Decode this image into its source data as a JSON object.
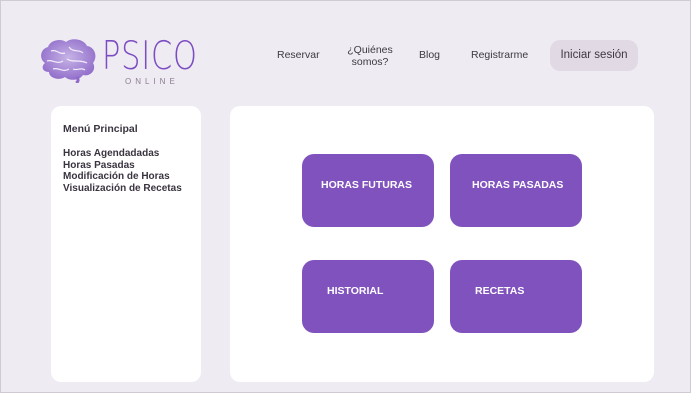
{
  "brand": {
    "name": "PSICO",
    "sub": "ONLINE",
    "accent": "#7c4dc2"
  },
  "nav": {
    "reservar": "Reservar",
    "quienes_line1": "¿Quiénes",
    "quienes_line2": "somos?",
    "blog": "Blog",
    "registrarme": "Registrarme",
    "login": "Iniciar sesión"
  },
  "sidebar": {
    "title": "Menú Principal",
    "items": [
      {
        "label": "Horas Agendadadas"
      },
      {
        "label": "Horas Pasadas"
      },
      {
        "label": "Modificación de Horas"
      },
      {
        "label": "Visualización de Recetas"
      }
    ]
  },
  "cards": [
    {
      "label": "HORAS FUTURAS",
      "color": "#8052bd"
    },
    {
      "label": "HORAS PASADAS",
      "color": "#8052bd"
    },
    {
      "label": "HISTORIAL",
      "color": "#8052bd"
    },
    {
      "label": "RECETAS",
      "color": "#8052bd"
    }
  ],
  "icons": {
    "logo": "brain-icon"
  }
}
